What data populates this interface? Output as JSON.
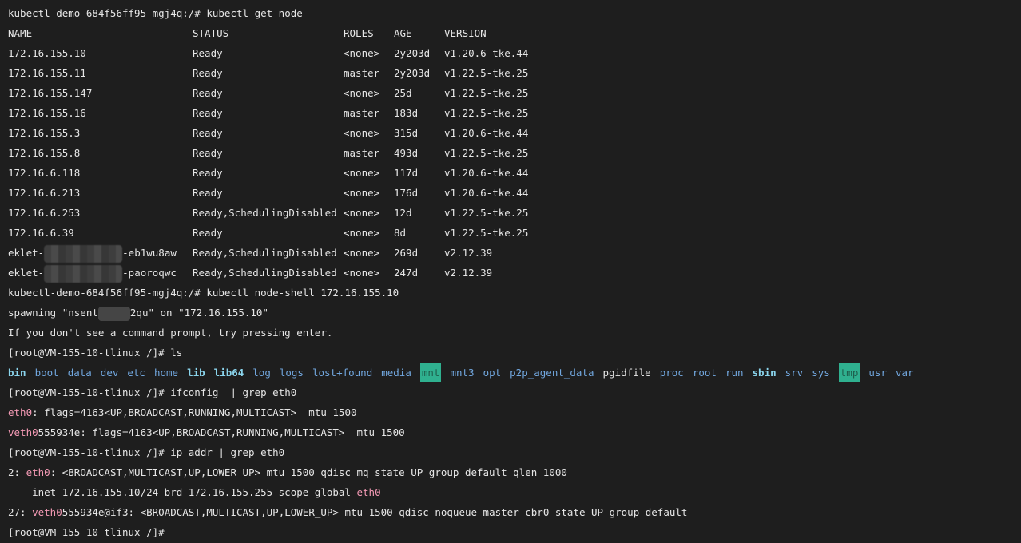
{
  "prompts": {
    "kubectl_host": "kubectl-demo-684f56ff95-mgj4q:/# ",
    "node_shell": "[root@VM-155-10-tlinux /]# "
  },
  "commands": {
    "get_node": "kubectl get node",
    "node_shell": "kubectl node-shell 172.16.155.10",
    "ls": "ls",
    "ifconfig": "ifconfig  | grep eth0",
    "ip_addr": "ip addr | grep eth0"
  },
  "node_table": {
    "headers": [
      "NAME",
      "STATUS",
      "ROLES",
      "AGE",
      "VERSION"
    ],
    "rows": [
      [
        "172.16.155.10",
        "Ready",
        "<none>",
        "2y203d",
        "v1.20.6-tke.44"
      ],
      [
        "172.16.155.11",
        "Ready",
        "master",
        "2y203d",
        "v1.22.5-tke.25"
      ],
      [
        "172.16.155.147",
        "Ready",
        "<none>",
        "25d",
        "v1.22.5-tke.25"
      ],
      [
        "172.16.155.16",
        "Ready",
        "master",
        "183d",
        "v1.22.5-tke.25"
      ],
      [
        "172.16.155.3",
        "Ready",
        "<none>",
        "315d",
        "v1.20.6-tke.44"
      ],
      [
        "172.16.155.8",
        "Ready",
        "master",
        "493d",
        "v1.22.5-tke.25"
      ],
      [
        "172.16.6.118",
        "Ready",
        "<none>",
        "117d",
        "v1.20.6-tke.44"
      ],
      [
        "172.16.6.213",
        "Ready",
        "<none>",
        "176d",
        "v1.20.6-tke.44"
      ],
      [
        "172.16.6.253",
        "Ready,SchedulingDisabled",
        "<none>",
        "12d",
        "v1.22.5-tke.25"
      ],
      [
        "172.16.6.39",
        "Ready",
        "<none>",
        "8d",
        "v1.22.5-tke.25"
      ]
    ],
    "eklet_rows": [
      {
        "prefix": "eklet-",
        "suffix": "-eb1wu8aw",
        "status": "Ready,SchedulingDisabled",
        "roles": "<none>",
        "age": "269d",
        "version": "v2.12.39"
      },
      {
        "prefix": "eklet-",
        "suffix": "-paoroqwc",
        "status": "Ready,SchedulingDisabled",
        "roles": "<none>",
        "age": "247d",
        "version": "v2.12.39"
      }
    ]
  },
  "spawning": {
    "prefix": "spawning \"nsent",
    "suffix": "2qu\" on \"172.16.155.10\""
  },
  "hint_line": "If you don't see a command prompt, try pressing enter.",
  "ls_output": [
    {
      "name": "bin",
      "style": "dir-b"
    },
    {
      "name": "boot",
      "style": "dir"
    },
    {
      "name": "data",
      "style": "dir"
    },
    {
      "name": "dev",
      "style": "dir"
    },
    {
      "name": "etc",
      "style": "dir"
    },
    {
      "name": "home",
      "style": "dir"
    },
    {
      "name": "lib",
      "style": "dir-b"
    },
    {
      "name": "lib64",
      "style": "dir-b"
    },
    {
      "name": "log",
      "style": "dir"
    },
    {
      "name": "logs",
      "style": "dir"
    },
    {
      "name": "lost+found",
      "style": "dir"
    },
    {
      "name": "media",
      "style": "dir"
    },
    {
      "name": "mnt",
      "style": "box"
    },
    {
      "name": "mnt3",
      "style": "dir"
    },
    {
      "name": "opt",
      "style": "dir"
    },
    {
      "name": "p2p_agent_data",
      "style": "dir"
    },
    {
      "name": "pgidfile",
      "style": "plain"
    },
    {
      "name": "proc",
      "style": "dir"
    },
    {
      "name": "root",
      "style": "dir"
    },
    {
      "name": "run",
      "style": "dir"
    },
    {
      "name": "sbin",
      "style": "dir-b"
    },
    {
      "name": "srv",
      "style": "dir"
    },
    {
      "name": "sys",
      "style": "dir"
    },
    {
      "name": "tmp",
      "style": "box"
    },
    {
      "name": "usr",
      "style": "dir"
    },
    {
      "name": "var",
      "style": "dir"
    }
  ],
  "ifconfig_output": [
    {
      "iface": "eth0",
      "rest": ": flags=4163<UP,BROADCAST,RUNNING,MULTICAST>  mtu 1500"
    },
    {
      "iface": "veth0",
      "iface_tail": "555934e",
      "rest": ": flags=4163<UP,BROADCAST,RUNNING,MULTICAST>  mtu 1500"
    }
  ],
  "ip_addr_output": {
    "line1_prefix": "2: ",
    "line1_iface": "eth0",
    "line1_rest": ": <BROADCAST,MULTICAST,UP,LOWER_UP> mtu 1500 qdisc mq state UP group default qlen 1000",
    "line2_text": "    inet 172.16.155.10/24 brd 172.16.155.255 scope global ",
    "line2_iface": "eth0",
    "line3_prefix": "27: ",
    "line3_iface": "veth0",
    "line3_tail": "555934e@if3",
    "line3_rest": ": <BROADCAST,MULTICAST,UP,LOWER_UP> mtu 1500 qdisc noqueue master cbr0 state UP group default"
  }
}
